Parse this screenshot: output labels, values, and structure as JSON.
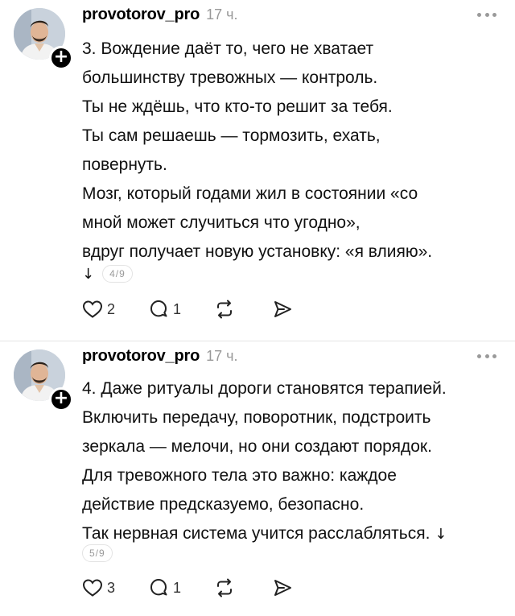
{
  "posts": [
    {
      "username": "provotorov_pro",
      "time": "17 ч.",
      "lines": [
        "3. Вождение даёт то, чего не хватает",
        "большинству тревожных — контроль.",
        "Ты не ждёшь, что кто-то решит за тебя.",
        "Ты сам решаешь — тормозить, ехать,",
        "повернуть.",
        "Мозг, который годами жил в состоянии «со",
        "мной может случиться что угодно»,",
        "вдруг получает новую установку: «я влияю»."
      ],
      "page_arrow": "↓",
      "page": "4/9",
      "likes": "2",
      "replies": "1"
    },
    {
      "username": "provotorov_pro",
      "time": "17 ч.",
      "lines": [
        "4. Даже ритуалы дороги становятся терапией.",
        "Включить передачу, поворотник, подстроить",
        "зеркала — мелочи, но они создают порядок.",
        "Для тревожного тела это важно: каждое",
        "действие предсказуемо, безопасно.",
        "Так нервная система учится расслабляться."
      ],
      "trailing_arrow": "↓",
      "page": "5/9",
      "likes": "3",
      "replies": "1"
    }
  ],
  "icons": {
    "avatar": "avatar-photo",
    "follow": "plus-icon",
    "more": "more-horizontal-icon",
    "like": "heart-icon",
    "reply": "comment-icon",
    "repost": "repost-icon",
    "share": "send-icon"
  },
  "colors": {
    "text": "#111111",
    "muted": "#999999",
    "divider": "#e5e5e5",
    "badge": "#000000"
  }
}
